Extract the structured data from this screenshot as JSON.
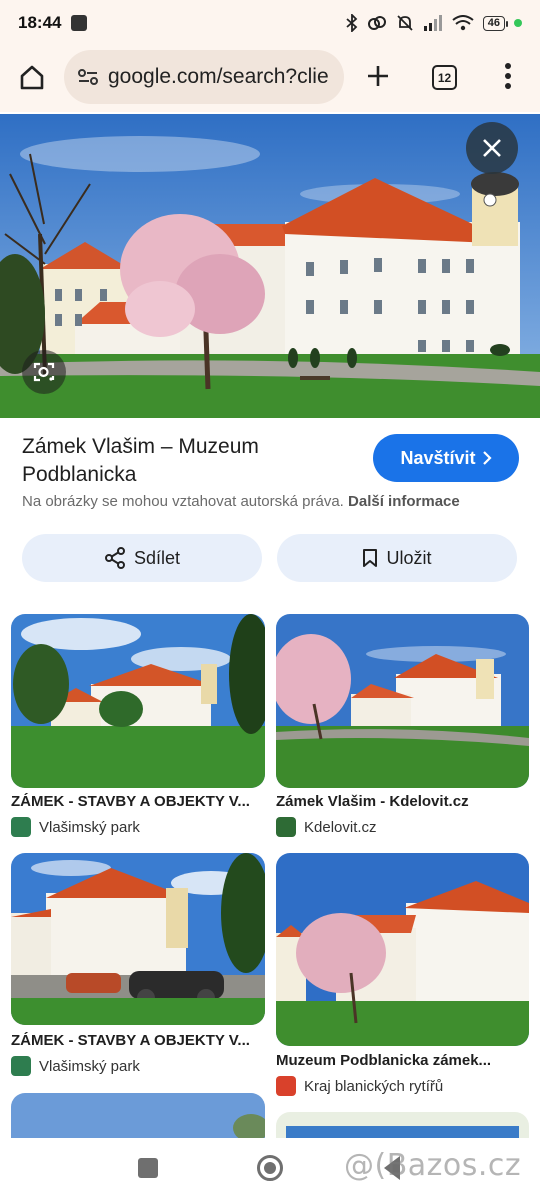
{
  "status_bar": {
    "time": "18:44",
    "battery": "46"
  },
  "toolbar": {
    "url": "google.com/search?clie",
    "tab_count": "12"
  },
  "result": {
    "title": "Zámek Vlašim – Muzeum Podblanicka",
    "visit_label": "Navštívit",
    "copyright_text": "Na obrázky se mohou vztahovat autorská práva.",
    "copyright_link": "Další informace",
    "share_label": "Sdílet",
    "save_label": "Uložit"
  },
  "related": [
    {
      "title": "ZÁMEK - STAVBY A OBJEKTY V...",
      "source": "Vlašimský park",
      "favicon_color": "#2e7d4f"
    },
    {
      "title": "Zámek Vlašim - Kdelovit.cz",
      "source": "Kdelovit.cz",
      "favicon_color": "#2e6b35"
    },
    {
      "title": "ZÁMEK - STAVBY A OBJEKTY V...",
      "source": "Vlašimský park",
      "favicon_color": "#2e7d4f"
    },
    {
      "title": "Muzeum Podblanicka zámek...",
      "source": "Kraj blanických rytířů",
      "favicon_color": "#d9412b"
    }
  ],
  "watermark": "@(Bazos.cz"
}
